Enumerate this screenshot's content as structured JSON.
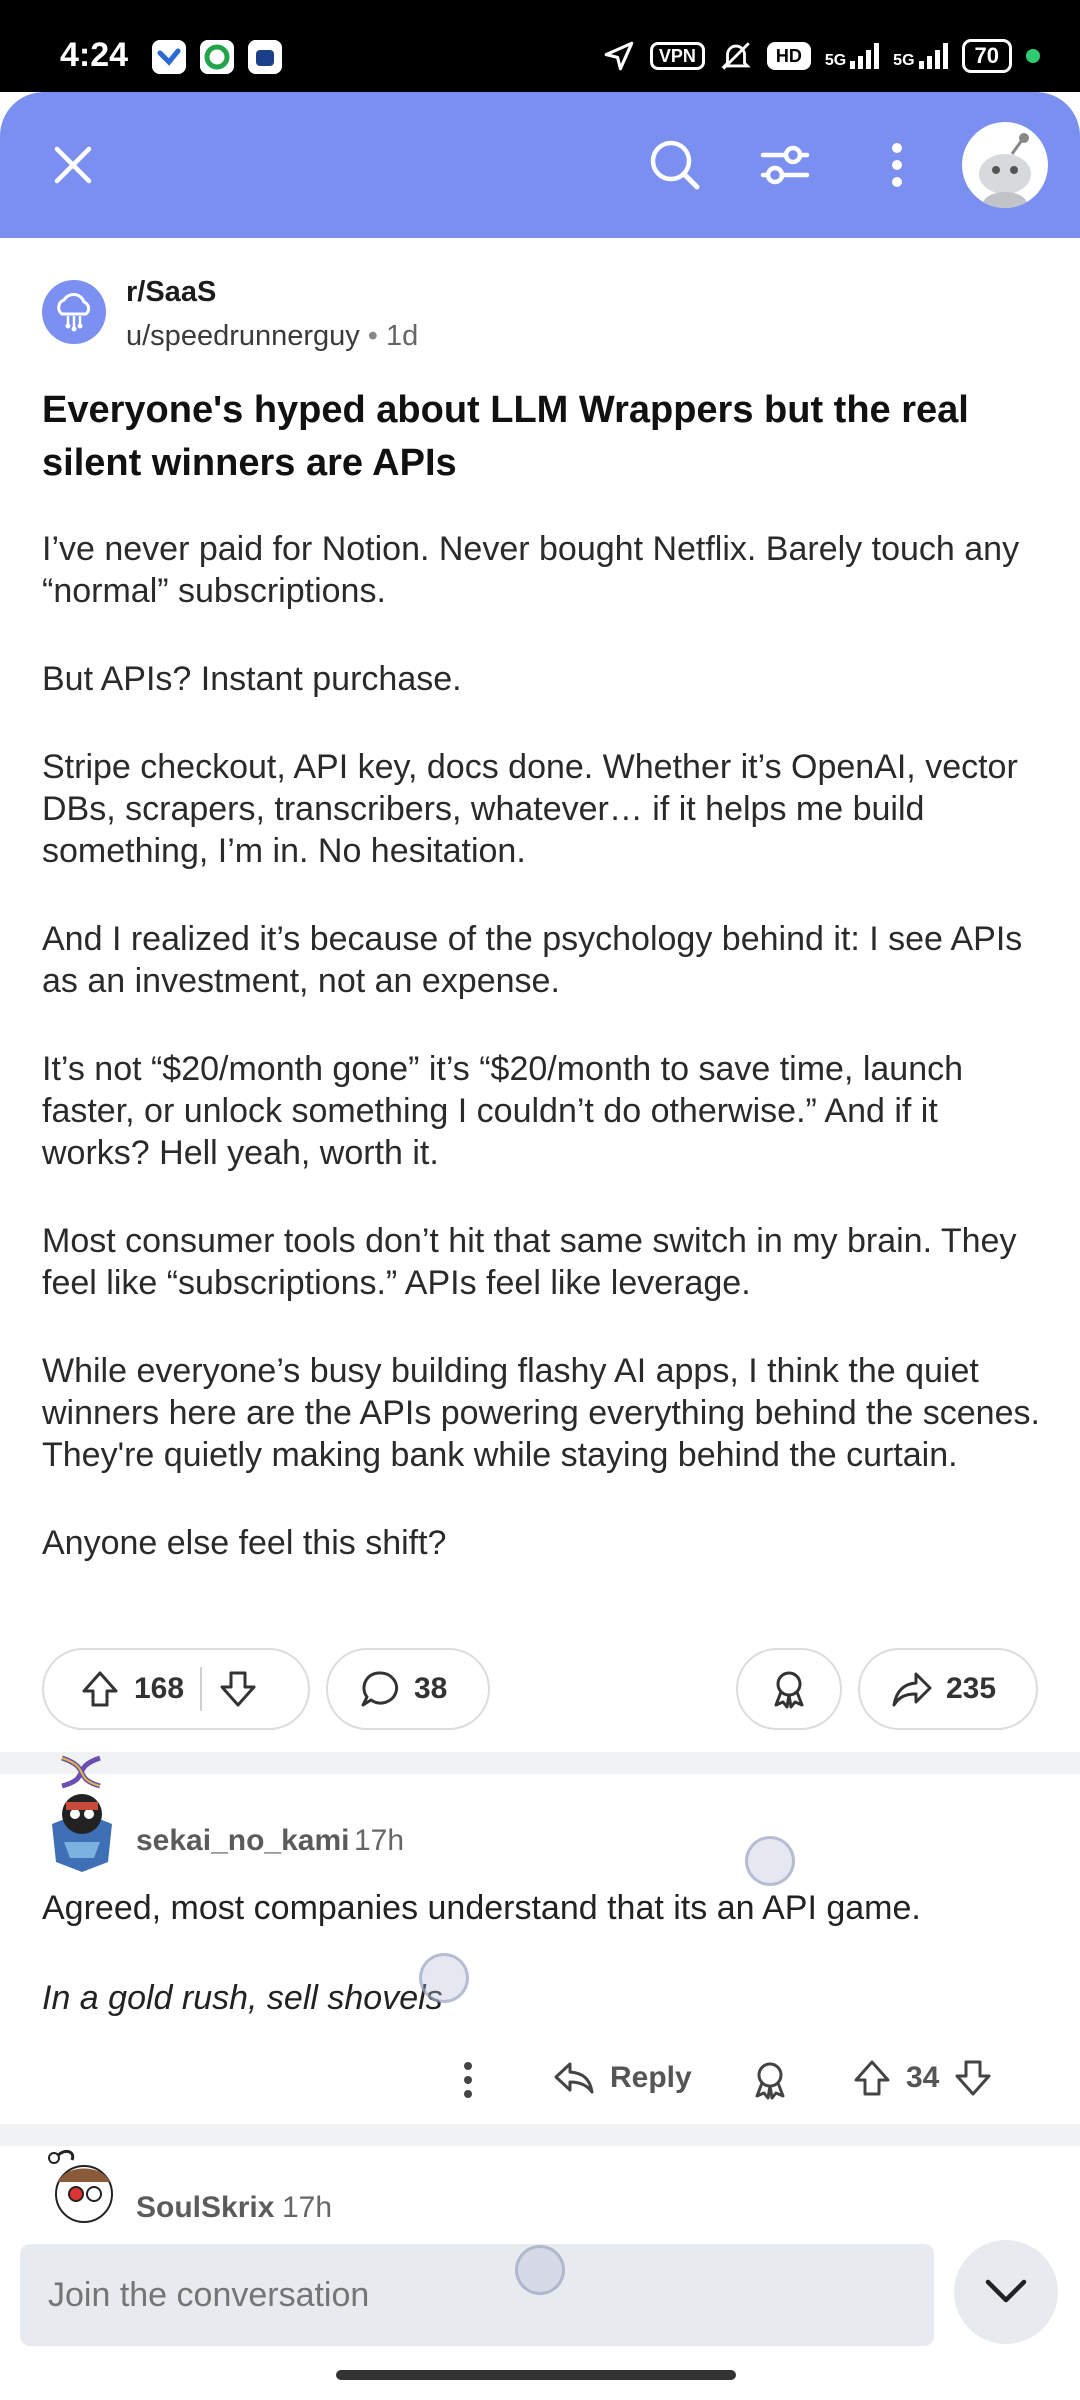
{
  "status_bar": {
    "time": "4:24",
    "vpn_label": "VPN",
    "hd_label": "HD",
    "net1": "5G",
    "net2": "5G",
    "battery": "70",
    "icons": [
      "location-icon",
      "vpn-icon",
      "mute-icon",
      "hd-icon",
      "signal-icon",
      "battery-icon"
    ]
  },
  "header": {
    "icons": [
      "close-icon",
      "search-icon",
      "filter-icon",
      "more-vertical-icon",
      "avatar-icon"
    ],
    "accent_color": "#7a8ff0"
  },
  "post": {
    "subreddit": "r/SaaS",
    "author": "u/speedrunnerguy",
    "separator": "•",
    "age": "1d",
    "title": "Everyone's hyped about LLM Wrappers but the real silent winners are APIs",
    "paragraphs": [
      "I’ve never paid for Notion. Never bought Netflix. Barely touch any “normal” subscriptions.",
      "But APIs? Instant purchase.",
      "Stripe checkout, API key, docs done. Whether it’s OpenAI, vector DBs, scrapers, transcribers, whatever… if it helps me build something, I’m in. No hesitation.",
      "And I realized it’s because of the psychology behind it: I see APIs as an investment, not an expense.",
      "It’s not “$20/month gone” it’s “$20/month to save time, launch faster, or unlock something I couldn’t do otherwise.” And if it works? Hell yeah, worth it.",
      "Most consumer tools don’t hit that same switch in my brain. They feel like “subscriptions.” APIs feel like leverage.",
      "While everyone’s busy building flashy AI apps, I think the quiet winners here are the APIs powering everything behind the scenes. They're quietly making bank while staying behind the curtain.",
      "Anyone else feel this shift?"
    ],
    "upvotes": "168",
    "comments": "38",
    "shares": "235"
  },
  "comments": [
    {
      "author": "sekai_no_kami",
      "age": "17h",
      "text": "Agreed, most companies understand that its an API game.",
      "text_italic": "In a gold rush, sell shovels",
      "reply_label": "Reply",
      "score": "34"
    },
    {
      "author": "SoulSkrix",
      "age": "17h"
    }
  ],
  "bottom": {
    "placeholder": "Join the conversation"
  }
}
